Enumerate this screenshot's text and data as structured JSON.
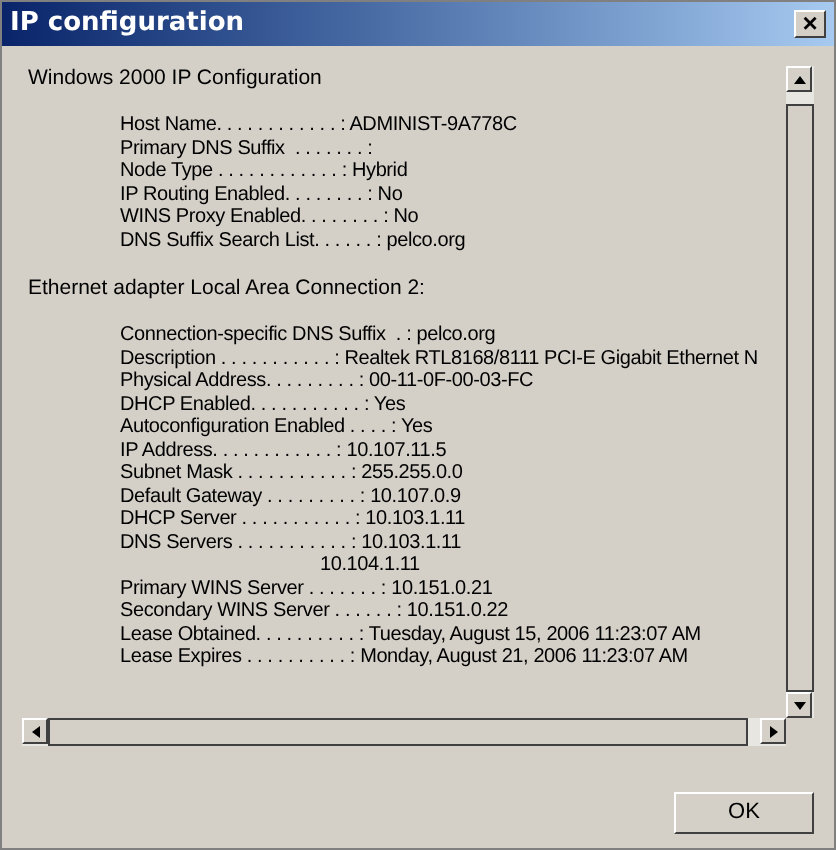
{
  "window": {
    "title": "IP configuration",
    "close_glyph": "×"
  },
  "sections": [
    {
      "heading": "Windows 2000 IP Configuration",
      "lines": [
        {
          "kind": "entry",
          "text": "Host Name. . . . . . . . . . . . : ADMINIST-9A778C"
        },
        {
          "kind": "entry",
          "text": "Primary DNS Suffix  . . . . . . . :"
        },
        {
          "kind": "entry",
          "text": "Node Type . . . . . . . . . . . . : Hybrid"
        },
        {
          "kind": "entry",
          "text": "IP Routing Enabled. . . . . . . . : No"
        },
        {
          "kind": "entry",
          "text": "WINS Proxy Enabled. . . . . . . . : No"
        },
        {
          "kind": "entry",
          "text": "DNS Suffix Search List. . . . . . : pelco.org"
        }
      ]
    },
    {
      "heading": "Ethernet adapter Local Area Connection 2:",
      "lines": [
        {
          "kind": "entry",
          "text": "Connection-specific DNS Suffix  . : pelco.org"
        },
        {
          "kind": "entry",
          "text": "Description . . . . . . . . . . . : Realtek RTL8168/8111 PCI-E Gigabit Ethernet N"
        },
        {
          "kind": "entry",
          "text": "Physical Address. . . . . . . . . : 00-11-0F-00-03-FC"
        },
        {
          "kind": "entry",
          "text": "DHCP Enabled. . . . . . . . . . . : Yes"
        },
        {
          "kind": "entry",
          "text": "Autoconfiguration Enabled . . . . : Yes"
        },
        {
          "kind": "entry",
          "text": "IP Address. . . . . . . . . . . . : 10.107.11.5"
        },
        {
          "kind": "entry",
          "text": "Subnet Mask . . . . . . . . . . . : 255.255.0.0"
        },
        {
          "kind": "entry",
          "text": "Default Gateway . . . . . . . . . : 10.107.0.9"
        },
        {
          "kind": "entry",
          "text": "DHCP Server . . . . . . . . . . . : 10.103.1.11"
        },
        {
          "kind": "entry",
          "text": "DNS Servers . . . . . . . . . . . : 10.103.1.11"
        },
        {
          "kind": "continuation",
          "text": "10.104.1.11"
        },
        {
          "kind": "entry",
          "text": "Primary WINS Server . . . . . . . : 10.151.0.21"
        },
        {
          "kind": "entry",
          "text": "Secondary WINS Server . . . . . . : 10.151.0.22"
        },
        {
          "kind": "entry",
          "text": "Lease Obtained. . . . . . . . . . : Tuesday, August 15, 2006 11:23:07 AM"
        },
        {
          "kind": "entry",
          "text": "Lease Expires . . . . . . . . . . : Monday, August 21, 2006 11:23:07 AM"
        }
      ]
    }
  ],
  "buttons": [
    {
      "label": "OK"
    }
  ]
}
